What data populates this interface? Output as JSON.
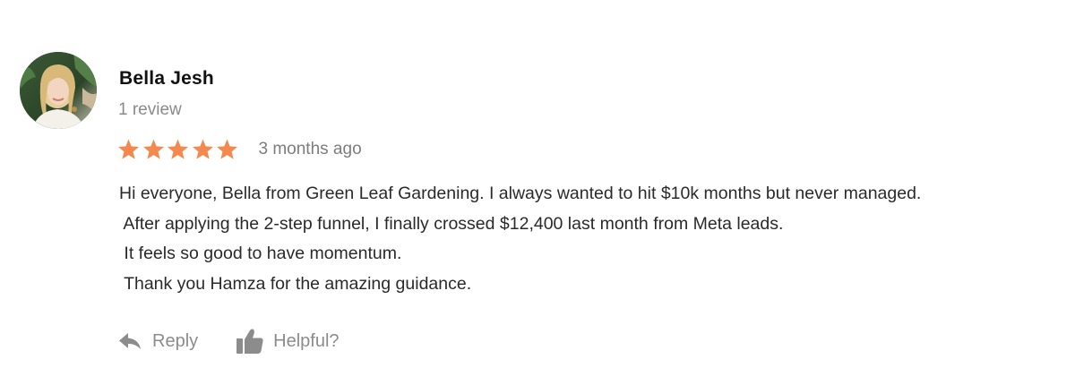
{
  "reviewer": {
    "name": "Bella Jesh",
    "review_count": "1 review",
    "avatar_icon": "user-photo-icon"
  },
  "rating": {
    "stars": 5,
    "max_stars": 5,
    "star_color": "#f4894f",
    "timestamp": "3 months ago"
  },
  "review": {
    "lines": [
      "Hi everyone, Bella from Green Leaf Gardening. I always wanted to hit $10k months but never managed.",
      " After applying the 2-step funnel, I finally crossed $12,400 last month from Meta leads.",
      " It feels so good to have momentum.",
      " Thank you Hamza for the amazing guidance."
    ]
  },
  "actions": {
    "reply_label": "Reply",
    "reply_icon": "reply-arrow-icon",
    "helpful_label": "Helpful?",
    "helpful_icon": "thumbs-up-icon"
  }
}
